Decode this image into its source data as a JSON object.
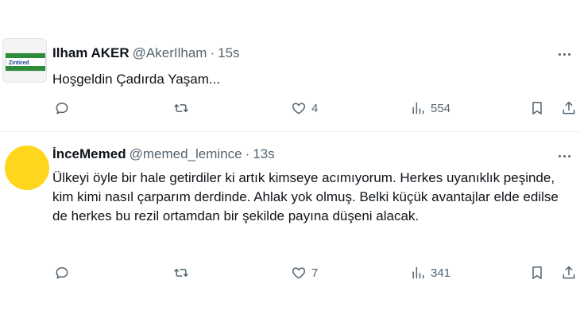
{
  "tweets": [
    {
      "author_name": "Ilham AKER",
      "handle": "@AkerIlham",
      "separator": "·",
      "time": "15s",
      "avatar_text": "Zintired",
      "text": "Hoşgeldin Çadırda Yaşam...",
      "reply_count": "",
      "retweet_count": "",
      "like_count": "4",
      "view_count": "554"
    },
    {
      "author_name": "İnceMemed",
      "handle": "@memed_lemince",
      "separator": "·",
      "time": "13s",
      "avatar_color": "#ffd51e",
      "text": "Ülkeyi öyle bir hale getirdiler ki artık kimseye acımıyorum. Herkes uyanıklık peşinde, kim kimi nasıl çarparım derdinde. Ahlak yok olmuş. Belki küçük avantajlar elde edilse de herkes bu rezil ortamdan bir şekilde payına düşeni alacak.",
      "reply_count": "",
      "retweet_count": "",
      "like_count": "7",
      "view_count": "341"
    }
  ],
  "colors": {
    "text": "#0f1419",
    "secondary": "#536471",
    "divider": "#eff3f4"
  },
  "icons": [
    "reply-icon",
    "retweet-icon",
    "like-icon",
    "views-icon",
    "bookmark-icon",
    "share-icon",
    "more-icon"
  ]
}
